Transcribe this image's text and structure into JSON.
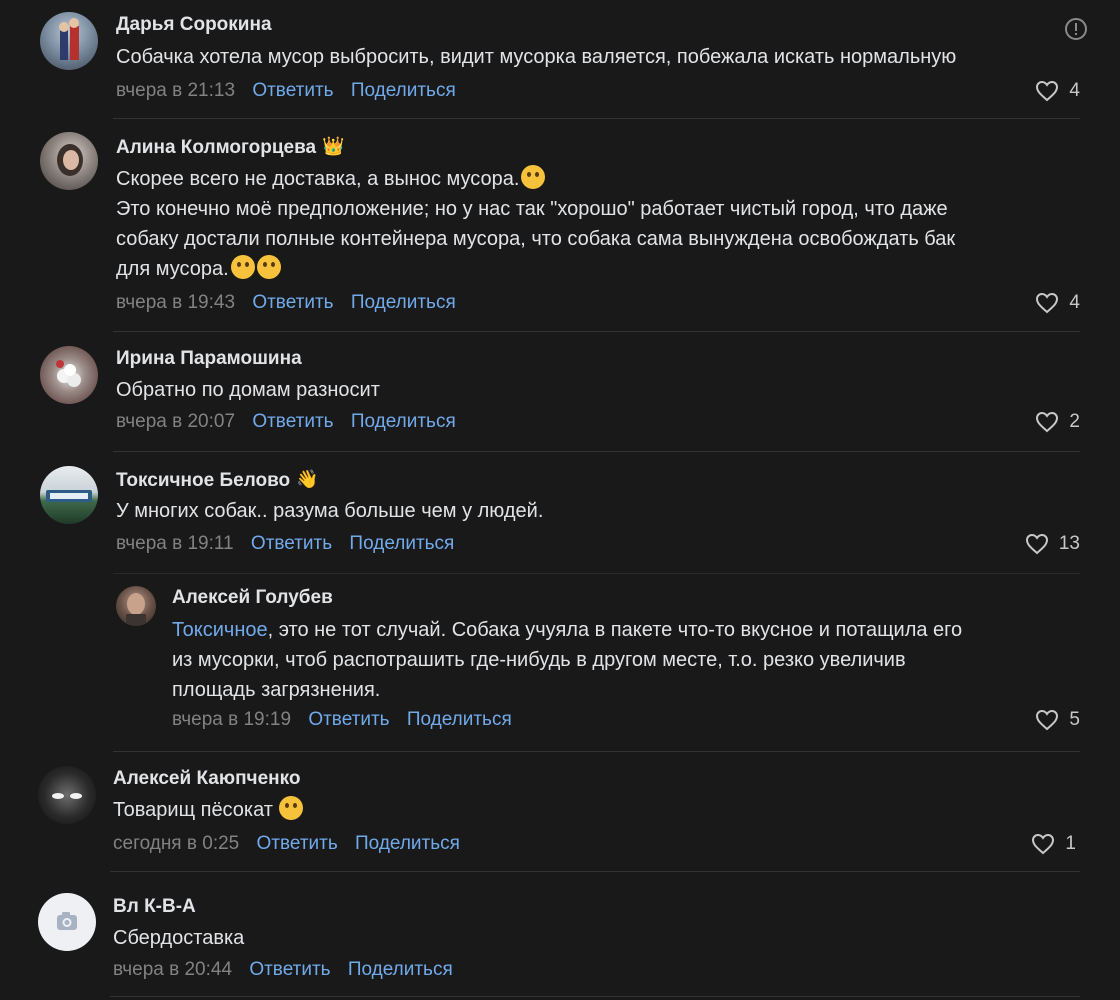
{
  "comments": [
    {
      "author": "Дарья Сорокина",
      "lines": [
        "Собачка хотела мусор выбросить, видит мусорка валяется, побежала искать нормальную"
      ],
      "time": "вчера в 21:13",
      "reply": "Ответить",
      "share": "Поделиться",
      "likes": "4"
    },
    {
      "author": "Алина Колмогорцева",
      "badge": "👑",
      "lines": [
        "Скорее всего не доставка, а вынос мусора.",
        "Это конечно моё предположение; но у нас так \"хорошо\" работает чистый город, что даже",
        "собаку достали полные контейнера мусора, что собака сама вынуждена освобождать бак",
        "для мусора."
      ],
      "time": "вчера в 19:43",
      "reply": "Ответить",
      "share": "Поделиться",
      "likes": "4"
    },
    {
      "author": "Ирина Парамошина",
      "lines": [
        "Обратно по домам разносит"
      ],
      "time": "вчера в 20:07",
      "reply": "Ответить",
      "share": "Поделиться",
      "likes": "2"
    },
    {
      "author": "Токсичное Белово",
      "badge": "👋",
      "lines": [
        "У многих собак.. разума больше чем у людей."
      ],
      "time": "вчера в 19:11",
      "reply": "Ответить",
      "share": "Поделиться",
      "likes": "13"
    },
    {
      "author": "Алексей Голубев",
      "mention": "Токсичное",
      "lines": [
        ", это не тот случай. Собака учуяла в пакете что-то вкусное и потащила его",
        "из мусорки, чтоб распотрашить где-нибудь в другом месте, т.о. резко увеличив",
        "площадь загрязнения."
      ],
      "time": "вчера в 19:19",
      "reply": "Ответить",
      "share": "Поделиться",
      "likes": "5"
    },
    {
      "author": "Алексей Каюпченко",
      "lines": [
        "Товарищ пёсокат"
      ],
      "time": "сегодня в 0:25",
      "reply": "Ответить",
      "share": "Поделиться",
      "likes": "1"
    },
    {
      "author": "Вл К-В-А",
      "lines": [
        "Сбердоставка"
      ],
      "time": "вчера в 20:44",
      "reply": "Ответить",
      "share": "Поделиться"
    }
  ],
  "colors": {
    "background": "#191919",
    "text": "#e1e3e6",
    "link": "#71aaeb",
    "meta": "#828282"
  }
}
